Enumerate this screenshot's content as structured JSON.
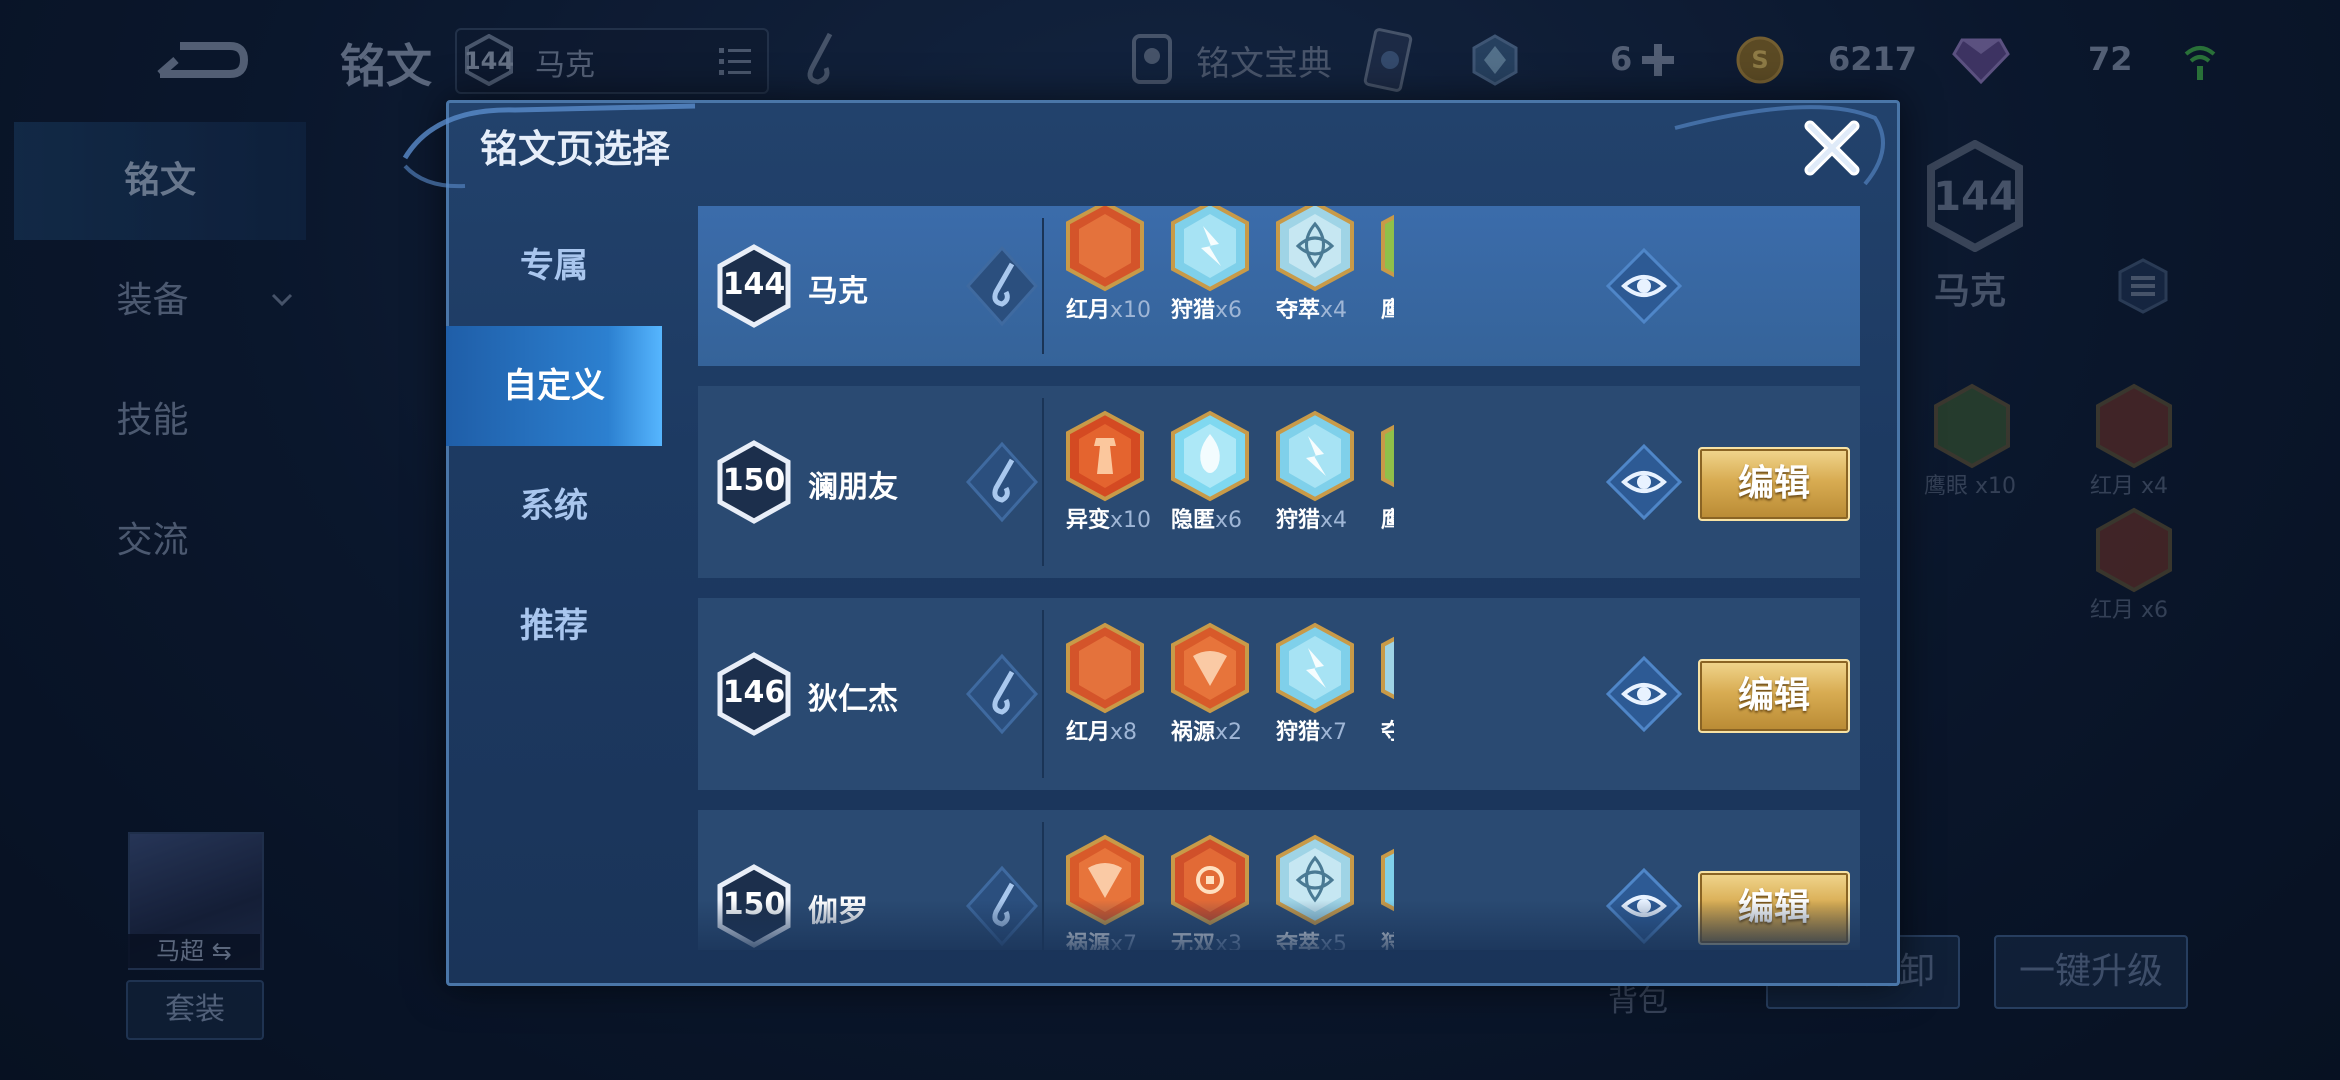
{
  "topbar": {
    "title": "铭文",
    "hero_level": "144",
    "hero_name": "马克",
    "codex_label": "铭文宝典",
    "resource1_value": "6",
    "coins": "6217",
    "gems": "72"
  },
  "nav": {
    "items": [
      {
        "label": "铭文"
      },
      {
        "label": "装备"
      },
      {
        "label": "技能"
      },
      {
        "label": "交流"
      }
    ],
    "portrait_name": "马超",
    "suit_label": "套装"
  },
  "background_right": {
    "level": "144",
    "name": "马克",
    "runes": [
      {
        "label": "鹰眼 x10",
        "color": "#6a9a3a"
      },
      {
        "label": "红月 x4",
        "color": "#c8502a"
      },
      {
        "label": "红月 x6",
        "color": "#c8502a"
      }
    ],
    "backpack_label": "背包",
    "btn_unload": "一键拆卸",
    "btn_upgrade": "一键升级"
  },
  "modal": {
    "title": "铭文页选择",
    "tabs": [
      {
        "label": "专属"
      },
      {
        "label": "自定义"
      },
      {
        "label": "系统"
      },
      {
        "label": "推荐"
      }
    ],
    "edit_label": "编辑",
    "pages": [
      {
        "level": "144",
        "name": "马克",
        "selected": true,
        "runes": [
          {
            "name": "红月",
            "count": "x10",
            "kind": "red-moon"
          },
          {
            "name": "狩猎",
            "count": "x6",
            "kind": "hunt"
          },
          {
            "name": "夺萃",
            "count": "x4",
            "kind": "seize"
          },
          {
            "name": "鹰眼",
            "count": "",
            "kind": "hawk-eye"
          }
        ]
      },
      {
        "level": "150",
        "name": "澜朋友",
        "selected": false,
        "runes": [
          {
            "name": "异变",
            "count": "x10",
            "kind": "mutation"
          },
          {
            "name": "隐匿",
            "count": "x6",
            "kind": "stealth"
          },
          {
            "name": "狩猎",
            "count": "x4",
            "kind": "hunt"
          },
          {
            "name": "鹰眼",
            "count": "",
            "kind": "hawk-eye"
          }
        ]
      },
      {
        "level": "146",
        "name": "狄仁杰",
        "selected": false,
        "runes": [
          {
            "name": "红月",
            "count": "x8",
            "kind": "red-moon"
          },
          {
            "name": "祸源",
            "count": "x2",
            "kind": "calamity"
          },
          {
            "name": "狩猎",
            "count": "x7",
            "kind": "hunt"
          },
          {
            "name": "夺萃",
            "count": "",
            "kind": "seize"
          }
        ]
      },
      {
        "level": "150",
        "name": "伽罗",
        "selected": false,
        "runes": [
          {
            "name": "祸源",
            "count": "x7",
            "kind": "calamity"
          },
          {
            "name": "无双",
            "count": "x3",
            "kind": "peerless"
          },
          {
            "name": "夺萃",
            "count": "x5",
            "kind": "seize"
          },
          {
            "name": "狩猎",
            "count": "",
            "kind": "hunt"
          }
        ]
      }
    ]
  },
  "colors": {
    "accent_blue": "#2c80d0",
    "gold_button": "#d8ac52",
    "red_rune": "#d0502a",
    "cyan_rune": "#7fd8f0",
    "green_rune": "#8fc04a"
  }
}
